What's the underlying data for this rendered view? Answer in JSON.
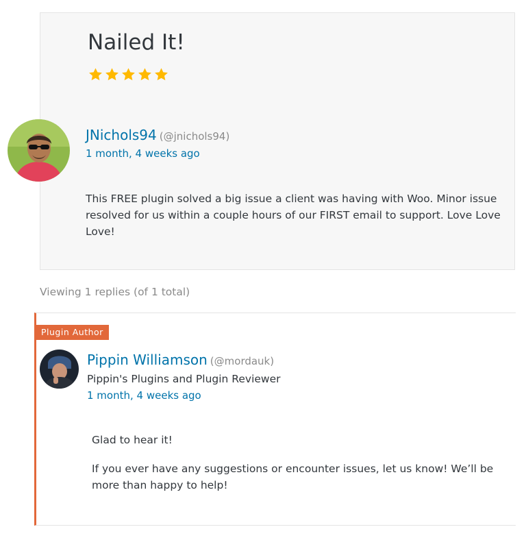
{
  "review": {
    "title": "Nailed It!",
    "rating": 5,
    "rating_max": 5,
    "star_color": "#ffb900",
    "author": {
      "name": "JNichols94",
      "handle": "(@jnichols94)",
      "date": "1 month, 4 weeks ago",
      "avatar_icon": "user-avatar-photo"
    },
    "body": "This FREE plugin solved a big issue a client was having with Woo. Minor issue resolved for us within a couple hours of our FIRST email to support. Love Love Love!"
  },
  "replies_summary": "Viewing 1 replies (of 1 total)",
  "reply": {
    "badge": "Plugin Author",
    "badge_color": "#e2683a",
    "author": {
      "name": "Pippin Williamson",
      "handle": "(@mordauk)",
      "title": "Pippin's Plugins and Plugin Reviewer",
      "date": "1 month, 4 weeks ago",
      "avatar_icon": "user-avatar-photo"
    },
    "paragraphs": [
      "Glad to hear it!",
      "If you ever have any suggestions or encounter issues, let us know! We’ll be more than happy to help!"
    ]
  },
  "colors": {
    "link": "#0073aa",
    "text": "#32373c",
    "muted": "#8a8a8a"
  }
}
